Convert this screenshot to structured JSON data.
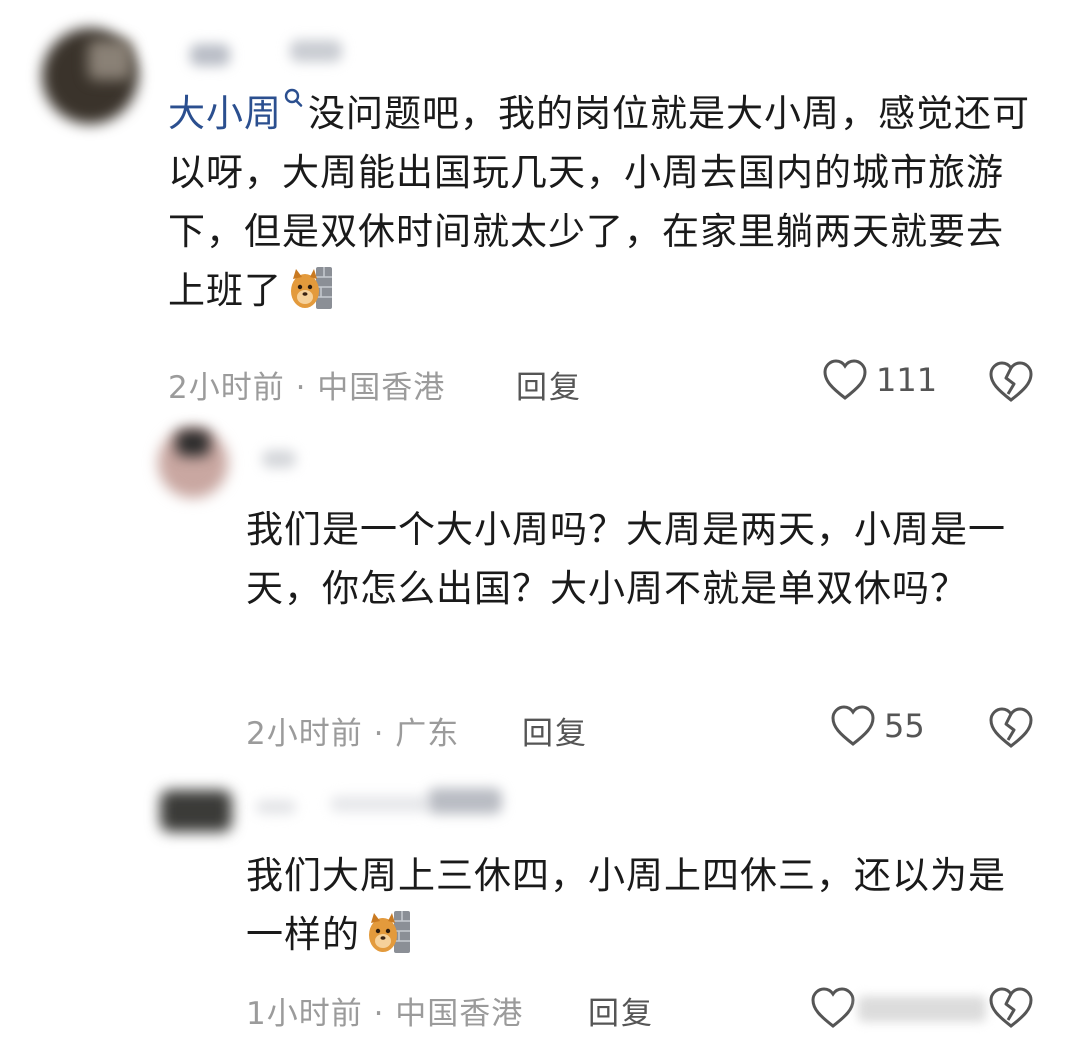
{
  "comments": [
    {
      "topic": "大小周",
      "text_line1": "没问题吧，我的岗位就是大小周，感觉",
      "text_rest": "还可以呀，大周能出国玩几天，小周去国内的城市旅游下，但是双休时间就太少了，在家里躺两天就要去上班了",
      "emoji": "dog-peek-emoji",
      "time": "2小时前",
      "location": "中国香港",
      "reply_label": "回复",
      "likes": "111"
    },
    {
      "text": "我们是一个大小周吗？大周是两天，小周是一天，你怎么出国？大小周不就是单双休吗？",
      "time": "2小时前",
      "location": "广东",
      "reply_label": "回复",
      "likes": "55"
    },
    {
      "text": "我们大周上三休四，小周上四休三，还以为是一样的",
      "emoji": "dog-peek-emoji",
      "time": "1小时前",
      "location": "中国香港",
      "reply_label": "回复",
      "likes": ""
    }
  ],
  "colors": {
    "topic_link": "#2b4f8f",
    "meta_gray": "#9b9b9b",
    "action_gray": "#555555"
  }
}
